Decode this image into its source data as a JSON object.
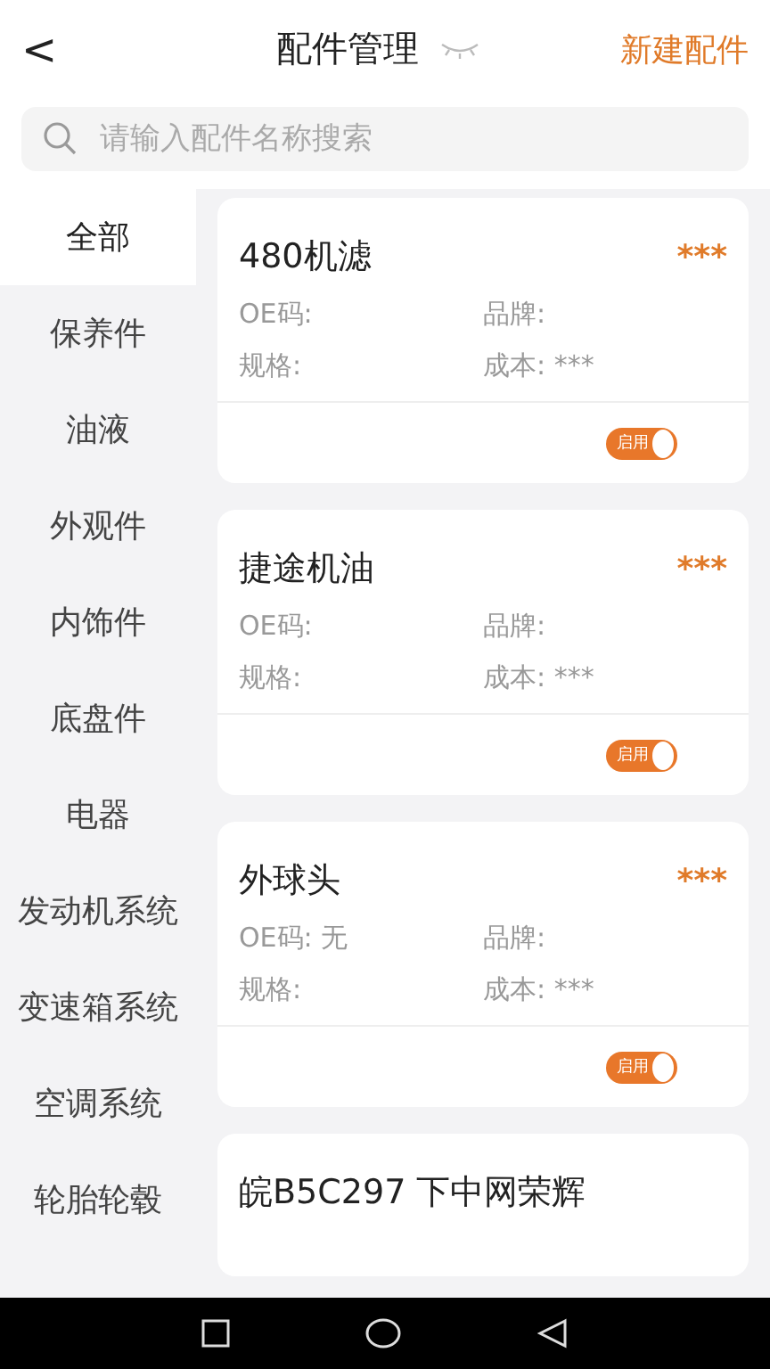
{
  "header": {
    "back": "<",
    "title": "配件管理",
    "price_hidden": true,
    "action": "新建配件"
  },
  "search": {
    "placeholder": "请输入配件名称搜索"
  },
  "categories": [
    {
      "label": "全部",
      "selected": true
    },
    {
      "label": "保养件",
      "selected": false
    },
    {
      "label": "油液",
      "selected": false
    },
    {
      "label": "外观件",
      "selected": false
    },
    {
      "label": "内饰件",
      "selected": false
    },
    {
      "label": "底盘件",
      "selected": false
    },
    {
      "label": "电器",
      "selected": false
    },
    {
      "label": "发动机系统",
      "selected": false
    },
    {
      "label": "变速箱系统",
      "selected": false
    },
    {
      "label": "空调系统",
      "selected": false
    },
    {
      "label": "轮胎轮毂",
      "selected": false
    }
  ],
  "parts": [
    {
      "name": "480机滤",
      "price": "***",
      "oe_label": "OE码:",
      "brand_label": "品牌:",
      "spec_label": "规格:",
      "cost_label": "成本:",
      "cost": "***",
      "status": "启用",
      "on": true
    },
    {
      "name": "捷途机油",
      "price": "***",
      "oe_label": "OE码:",
      "brand_label": "品牌:",
      "spec_label": "规格:",
      "cost_label": "成本:",
      "cost": "***",
      "status": "启用",
      "on": true
    },
    {
      "name": "外球头",
      "price": "***",
      "oe_label": "OE码:",
      "oe": "无",
      "brand_label": "品牌:",
      "spec_label": "规格:",
      "cost_label": "成本:",
      "cost": "***",
      "status": "启用",
      "on": true
    },
    {
      "name": "皖B5C297 下中网荣辉"
    }
  ]
}
